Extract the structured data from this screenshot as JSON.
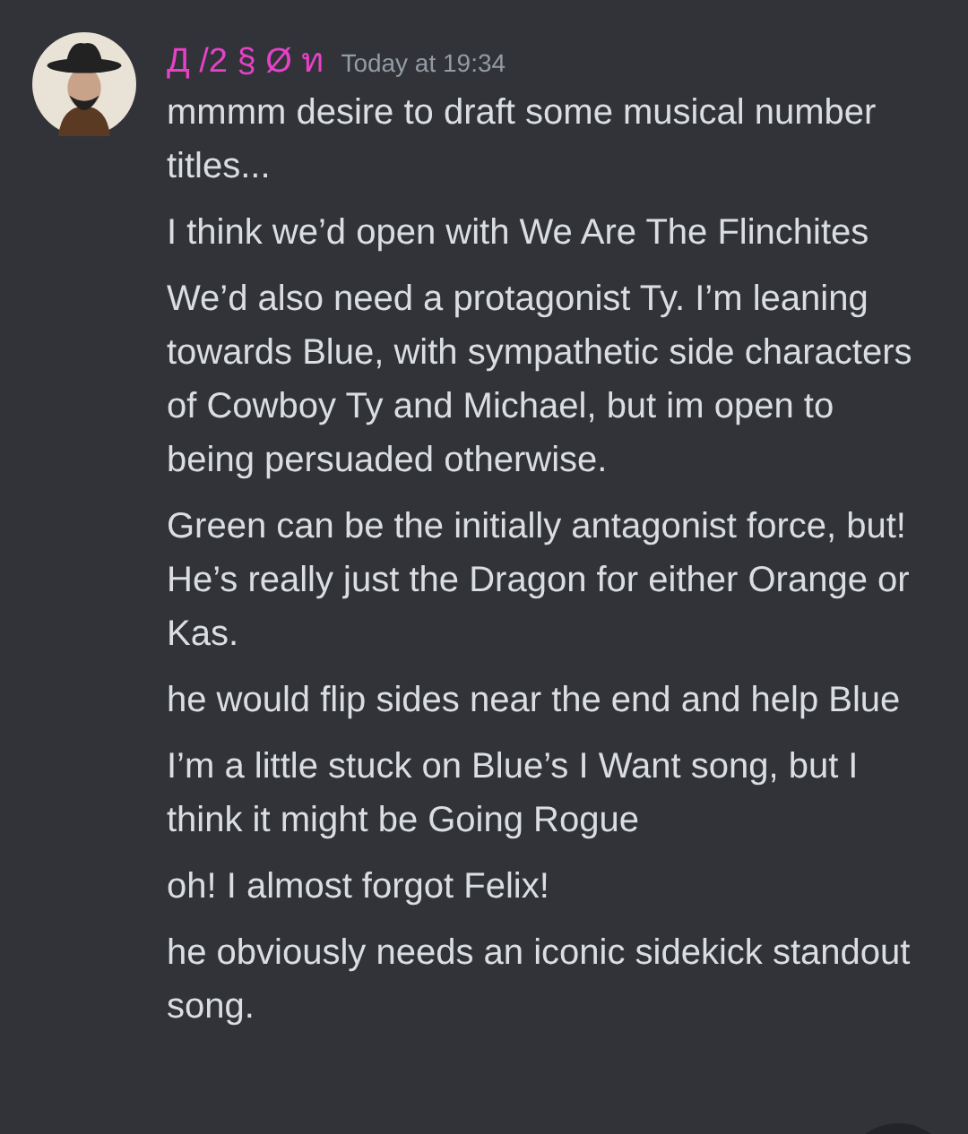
{
  "message": {
    "author": "Д /2 § Ø ท",
    "timestamp": "Today at 19:34",
    "lines": [
      "mmmm desire to draft some musical number titles...",
      "I think we’d open with We Are The Flinchites",
      "We’d also need a protagonist Ty. I’m leaning towards Blue, with sympathetic side characters of Cowboy Ty and Michael, but im open to being persuaded otherwise.",
      "Green can be the initially antagonist force, but! He’s really just the Dragon for either Orange or Kas.",
      "he would flip sides near the end and help Blue",
      "I’m a little stuck on Blue’s I Want song, but I think it might be Going Rogue",
      "oh! I almost forgot Felix!",
      "he obviously needs an iconic sidekick standout song."
    ]
  }
}
